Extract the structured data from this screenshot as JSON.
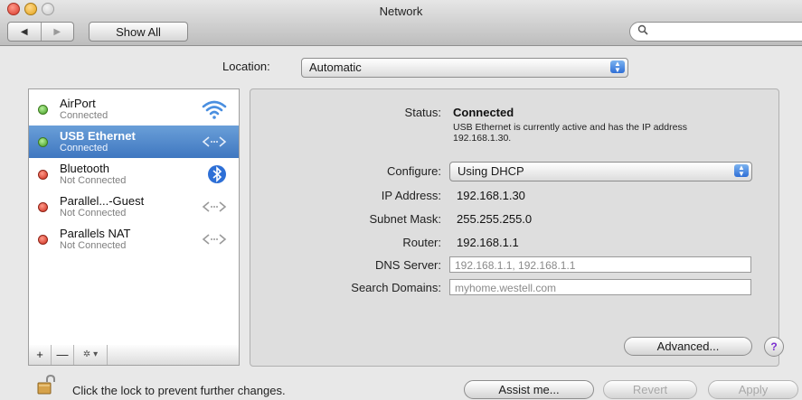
{
  "window": {
    "title": "Network"
  },
  "toolbar": {
    "back_glyph": "◀",
    "forward_glyph": "▶",
    "show_all_label": "Show All",
    "search_placeholder": "",
    "search_icon": "magnifier-icon"
  },
  "location": {
    "label": "Location:",
    "value": "Automatic"
  },
  "services": [
    {
      "name": "AirPort",
      "status": "Connected",
      "status_color": "green",
      "icon": "wifi-icon",
      "selected": false
    },
    {
      "name": "USB Ethernet",
      "status": "Connected",
      "status_color": "green",
      "icon": "ethernet-arrows-icon",
      "selected": true
    },
    {
      "name": "Bluetooth",
      "status": "Not Connected",
      "status_color": "red",
      "icon": "bluetooth-icon",
      "selected": false
    },
    {
      "name": "Parallel...-Guest",
      "status": "Not Connected",
      "status_color": "red",
      "icon": "ethernet-arrows-icon",
      "selected": false
    },
    {
      "name": "Parallels NAT",
      "status": "Not Connected",
      "status_color": "red",
      "icon": "ethernet-arrows-icon",
      "selected": false
    }
  ],
  "service_tools": {
    "add": "+",
    "remove": "—",
    "action": "✲ ▾"
  },
  "detail": {
    "status_label": "Status:",
    "status_value": "Connected",
    "status_desc": "USB Ethernet is currently active and has the IP address 192.168.1.30.",
    "configure_label": "Configure:",
    "configure_value": "Using DHCP",
    "ip_label": "IP Address:",
    "ip_value": "192.168.1.30",
    "subnet_label": "Subnet Mask:",
    "subnet_value": "255.255.255.0",
    "router_label": "Router:",
    "router_value": "192.168.1.1",
    "dns_label": "DNS Server:",
    "dns_value": "192.168.1.1, 192.168.1.1",
    "search_label": "Search Domains:",
    "search_value": "myhome.westell.com",
    "advanced_label": "Advanced...",
    "help_label": "?"
  },
  "footer": {
    "lock_text": "Click the lock to prevent further changes.",
    "assist_label": "Assist me...",
    "revert_label": "Revert",
    "apply_label": "Apply"
  },
  "colors": {
    "selection": "#3f77c0",
    "status_green": "#3d9a1e",
    "status_red": "#cc2a1a",
    "help_purple": "#7b2fd0"
  }
}
